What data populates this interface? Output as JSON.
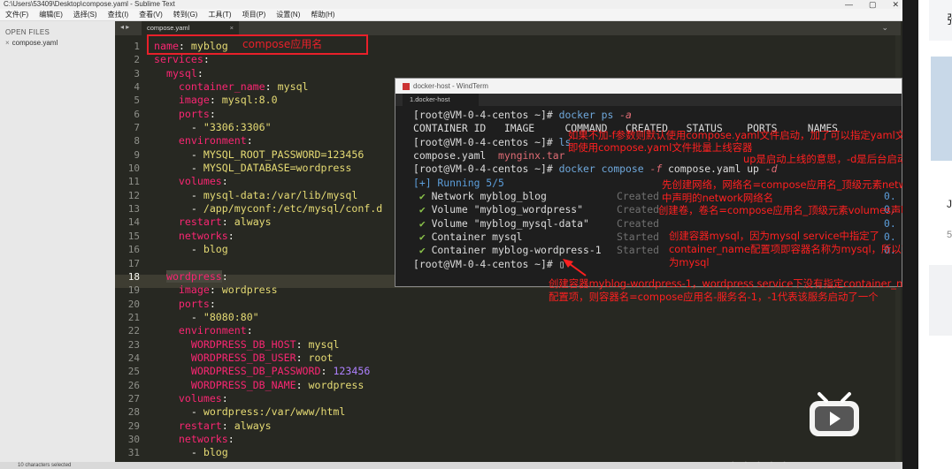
{
  "window": {
    "title": "C:\\Users\\53409\\Desktop\\compose.yaml - Sublime Text",
    "controls": [
      "—",
      "▢",
      "✕"
    ]
  },
  "menu": [
    "文件(F)",
    "编辑(E)",
    "选择(S)",
    "查找(I)",
    "查看(V)",
    "转到(G)",
    "工具(T)",
    "项目(P)",
    "设置(N)",
    "帮助(H)"
  ],
  "sidebar": {
    "header": "OPEN FILES",
    "files": [
      "compose.yaml"
    ]
  },
  "tabs": [
    {
      "label": "compose.yaml",
      "close": "×"
    }
  ],
  "editor": {
    "line_numbers": [
      "1",
      "2",
      "3",
      "4",
      "5",
      "6",
      "7",
      "8",
      "9",
      "10",
      "11",
      "12",
      "13",
      "14",
      "15",
      "16",
      "17",
      "18",
      "19",
      "20",
      "21",
      "22",
      "23",
      "24",
      "25",
      "26",
      "27",
      "28",
      "29",
      "30",
      "31"
    ],
    "current_line": "18",
    "lines": [
      [
        {
          "t": "k",
          "s": "name"
        },
        {
          "t": "p",
          "s": ": "
        },
        {
          "t": "v",
          "s": "myblog"
        }
      ],
      [
        {
          "t": "k",
          "s": "services"
        },
        {
          "t": "p",
          "s": ":"
        }
      ],
      [
        {
          "t": "p",
          "s": "  "
        },
        {
          "t": "k",
          "s": "mysql"
        },
        {
          "t": "p",
          "s": ":"
        }
      ],
      [
        {
          "t": "p",
          "s": "    "
        },
        {
          "t": "k",
          "s": "container_name"
        },
        {
          "t": "p",
          "s": ": "
        },
        {
          "t": "v",
          "s": "mysql"
        }
      ],
      [
        {
          "t": "p",
          "s": "    "
        },
        {
          "t": "k",
          "s": "image"
        },
        {
          "t": "p",
          "s": ": "
        },
        {
          "t": "v",
          "s": "mysql:8.0"
        }
      ],
      [
        {
          "t": "p",
          "s": "    "
        },
        {
          "t": "k",
          "s": "ports"
        },
        {
          "t": "p",
          "s": ":"
        }
      ],
      [
        {
          "t": "p",
          "s": "      - "
        },
        {
          "t": "v",
          "s": "\"3306:3306\""
        }
      ],
      [
        {
          "t": "p",
          "s": "    "
        },
        {
          "t": "k",
          "s": "environment"
        },
        {
          "t": "p",
          "s": ":"
        }
      ],
      [
        {
          "t": "p",
          "s": "      - "
        },
        {
          "t": "v",
          "s": "MYSQL_ROOT_PASSWORD=123456"
        }
      ],
      [
        {
          "t": "p",
          "s": "      - "
        },
        {
          "t": "v",
          "s": "MYSQL_DATABASE=wordpress"
        }
      ],
      [
        {
          "t": "p",
          "s": "    "
        },
        {
          "t": "k",
          "s": "volumes"
        },
        {
          "t": "p",
          "s": ":"
        }
      ],
      [
        {
          "t": "p",
          "s": "      - "
        },
        {
          "t": "v",
          "s": "mysql-data:/var/lib/mysql"
        }
      ],
      [
        {
          "t": "p",
          "s": "      - "
        },
        {
          "t": "v",
          "s": "/app/myconf:/etc/mysql/conf.d"
        }
      ],
      [
        {
          "t": "p",
          "s": "    "
        },
        {
          "t": "k",
          "s": "restart"
        },
        {
          "t": "p",
          "s": ": "
        },
        {
          "t": "v",
          "s": "always"
        }
      ],
      [
        {
          "t": "p",
          "s": "    "
        },
        {
          "t": "k",
          "s": "networks"
        },
        {
          "t": "p",
          "s": ":"
        }
      ],
      [
        {
          "t": "p",
          "s": "      - "
        },
        {
          "t": "v",
          "s": "blog"
        }
      ],
      [
        {
          "t": "p",
          "s": ""
        }
      ],
      [
        {
          "t": "p",
          "s": "  "
        },
        {
          "t": "k wsel",
          "s": "wordpress"
        },
        {
          "t": "p",
          "s": ":"
        }
      ],
      [
        {
          "t": "p",
          "s": "    "
        },
        {
          "t": "k",
          "s": "image"
        },
        {
          "t": "p",
          "s": ": "
        },
        {
          "t": "v",
          "s": "wordpress"
        }
      ],
      [
        {
          "t": "p",
          "s": "    "
        },
        {
          "t": "k",
          "s": "ports"
        },
        {
          "t": "p",
          "s": ":"
        }
      ],
      [
        {
          "t": "p",
          "s": "      - "
        },
        {
          "t": "v",
          "s": "\"8080:80\""
        }
      ],
      [
        {
          "t": "p",
          "s": "    "
        },
        {
          "t": "k",
          "s": "environment"
        },
        {
          "t": "p",
          "s": ":"
        }
      ],
      [
        {
          "t": "p",
          "s": "      "
        },
        {
          "t": "k",
          "s": "WORDPRESS_DB_HOST"
        },
        {
          "t": "p",
          "s": ": "
        },
        {
          "t": "v",
          "s": "mysql"
        }
      ],
      [
        {
          "t": "p",
          "s": "      "
        },
        {
          "t": "k",
          "s": "WORDPRESS_DB_USER"
        },
        {
          "t": "p",
          "s": ": "
        },
        {
          "t": "v",
          "s": "root"
        }
      ],
      [
        {
          "t": "p",
          "s": "      "
        },
        {
          "t": "k",
          "s": "WORDPRESS_DB_PASSWORD"
        },
        {
          "t": "p",
          "s": ": "
        },
        {
          "t": "n",
          "s": "123456"
        }
      ],
      [
        {
          "t": "p",
          "s": "      "
        },
        {
          "t": "k",
          "s": "WORDPRESS_DB_NAME"
        },
        {
          "t": "p",
          "s": ": "
        },
        {
          "t": "v",
          "s": "wordpress"
        }
      ],
      [
        {
          "t": "p",
          "s": "    "
        },
        {
          "t": "k",
          "s": "volumes"
        },
        {
          "t": "p",
          "s": ":"
        }
      ],
      [
        {
          "t": "p",
          "s": "      - "
        },
        {
          "t": "v",
          "s": "wordpress:/var/www/html"
        }
      ],
      [
        {
          "t": "p",
          "s": "    "
        },
        {
          "t": "k",
          "s": "restart"
        },
        {
          "t": "p",
          "s": ": "
        },
        {
          "t": "v",
          "s": "always"
        }
      ],
      [
        {
          "t": "p",
          "s": "    "
        },
        {
          "t": "k",
          "s": "networks"
        },
        {
          "t": "p",
          "s": ":"
        }
      ],
      [
        {
          "t": "p",
          "s": "      - "
        },
        {
          "t": "v",
          "s": "blog"
        }
      ]
    ]
  },
  "status": "10 characters selected",
  "annotation_name": "compose应用名",
  "terminal": {
    "title": "docker-host - WindTerm",
    "tab": "1.docker-host",
    "lines": [
      [
        {
          "t": "pr",
          "s": "[root@VM-0-4-centos ~]# "
        },
        {
          "t": "cmd",
          "s": "docker ps "
        },
        {
          "t": "opt",
          "s": "-a"
        }
      ],
      [
        {
          "t": "pr",
          "s": "CONTAINER ID   IMAGE     COMMAND   CREATED   STATUS    PORTS     NAMES"
        }
      ],
      [
        {
          "t": "pr",
          "s": "[root@VM-0-4-centos ~]# "
        },
        {
          "t": "cmd",
          "s": "ls"
        }
      ],
      [
        {
          "t": "pr",
          "s": "compose.yaml  "
        },
        {
          "t": "red",
          "s": "mynginx.tar"
        }
      ],
      [
        {
          "t": "pr",
          "s": "[root@VM-0-4-centos ~]# "
        },
        {
          "t": "cmd",
          "s": "docker compose "
        },
        {
          "t": "opt",
          "s": "-f"
        },
        {
          "t": "pr",
          "s": " compose.yaml up "
        },
        {
          "t": "opt",
          "s": "-d"
        }
      ],
      [
        {
          "t": "blu",
          "s": "[+] Running 5/5"
        }
      ],
      [
        {
          "t": "grn",
          "s": " ✔ "
        },
        {
          "t": "pr",
          "s": "Network myblog_blog"
        }
      ],
      [
        {
          "t": "grn",
          "s": " ✔ "
        },
        {
          "t": "pr",
          "s": "Volume \"myblog_wordpress\""
        }
      ],
      [
        {
          "t": "grn",
          "s": " ✔ "
        },
        {
          "t": "pr",
          "s": "Volume \"myblog_mysql-data\""
        }
      ],
      [
        {
          "t": "grn",
          "s": " ✔ "
        },
        {
          "t": "pr",
          "s": "Container mysql"
        }
      ],
      [
        {
          "t": "grn",
          "s": " ✔ "
        },
        {
          "t": "pr",
          "s": "Container myblog-wordpress-1"
        }
      ],
      [
        {
          "t": "pr",
          "s": "[root@VM-0-4-centos ~]# ▯"
        }
      ]
    ],
    "statuses": [
      "",
      "",
      "",
      "",
      "",
      "",
      "Created",
      "Created",
      "Created",
      "Started",
      "Started",
      ""
    ],
    "times": [
      "0.",
      "0.",
      "0.",
      "0.",
      "0."
    ]
  },
  "annotations": [
    "如果不加-f参数则默认使用compose.yaml文件启动，加了可以指定yaml文件启动，",
    "即使用compose.yaml文件批量上线容器",
    "up是启动上线的意思，-d是后台启动",
    "先创建网络，网络名=compose应用名_顶级元素networks",
    "中声明的network网络名",
    "创建卷，卷名=compose应用名_顶级元素volumes声明的卷名",
    "创建容器mysql，因为mysql service中指定了",
    "container_name配置项即容器名称为mysql，所以容器名",
    "为mysql",
    "创建容器myblog-wordpress-1，wordpress service下没有指定container_name",
    "配置项，则容器名=compose应用名-服务名-1，-1代表该服务启动了一个"
  ],
  "right": {
    "t1": "张",
    "t2": "J",
    "t3": "5"
  },
  "watermark": "· · · · ·",
  "colors": {
    "accent_red": "#e8202a",
    "monokai_bg": "#272822"
  }
}
